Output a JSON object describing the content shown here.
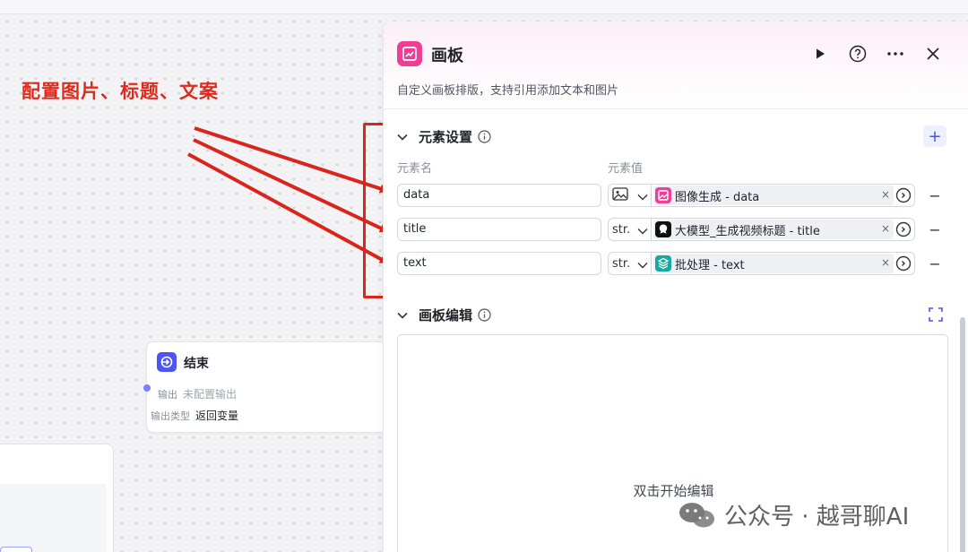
{
  "annotation": {
    "text": "配置图片、标题、文案",
    "color": "#e02a1c"
  },
  "end_node": {
    "icon": "end-exit-icon",
    "title": "结束",
    "output_label": "输出",
    "output_value": "未配置输出",
    "output_type_label": "输出类型",
    "output_type_value": "返回变量"
  },
  "panel": {
    "icon": "canvas-board-icon",
    "title": "画板",
    "description": "自定义画板排版，支持引用添加文本和图片",
    "header_icons": [
      "play-icon",
      "help-circle-icon",
      "more-dots-icon",
      "close-icon"
    ],
    "accent": "#ef3e93",
    "element_settings": {
      "title": "元素设置",
      "add_label": "+",
      "col_name": "元素名",
      "col_value": "元素值",
      "rows": [
        {
          "name": "data",
          "type": "image-type-icon",
          "type_label": "",
          "ref_icon": "image-gen-icon",
          "ref_color": "#ef3e93",
          "ref": "图像生成 - data",
          "clear": "×",
          "remove": "−"
        },
        {
          "name": "title",
          "type": "string-type",
          "type_label": "str.",
          "ref_icon": "llm-model-icon",
          "ref_color": "#111111",
          "ref": "大模型_生成视频标题 - title",
          "clear": "×",
          "remove": "−"
        },
        {
          "name": "text",
          "type": "string-type",
          "type_label": "str.",
          "ref_icon": "batch-layers-icon",
          "ref_color": "#14a8a0",
          "ref": "批处理 - text",
          "clear": "×",
          "remove": "−"
        }
      ]
    },
    "canvas_edit": {
      "title": "画板编辑",
      "hint": "双击开始编辑"
    }
  },
  "watermark": {
    "icon": "wechat-icon",
    "text": "公众号 · 越哥聊AI"
  }
}
